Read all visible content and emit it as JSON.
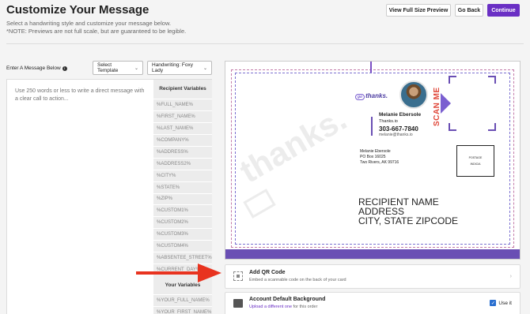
{
  "header": {
    "title": "Customize Your Message",
    "subtitle_line1": "Select a handwriting style and customize your message below.",
    "subtitle_line2": "*NOTE: Previews are not full scale, but are guaranteed to be legible.",
    "view_full_size_label": "View Full Size Preview",
    "go_back_label": "Go Back",
    "continue_label": "Continue"
  },
  "controls": {
    "enter_message_label": "Enter A Message Below",
    "template_select": "Select Template",
    "handwriting_select": "Handwriting: Foxy Lady"
  },
  "message": {
    "placeholder": "Use 250 words or less to write a direct message with a clear call to action..."
  },
  "recipient_variables": {
    "heading": "Recipient Variables",
    "items": [
      "%FULL_NAME%",
      "%FIRST_NAME%",
      "%LAST_NAME%",
      "%COMPANY%",
      "%ADDRESS%",
      "%ADDRESS2%",
      "%CITY%",
      "%STATE%",
      "%ZIP%",
      "%CUSTOM1%",
      "%CUSTOM2%",
      "%CUSTOM3%",
      "%CUSTOM4%",
      "%ABSENTEE_STREET%",
      "%CURRENT_DAY%"
    ]
  },
  "your_variables": {
    "heading": "Your Variables",
    "items": [
      "%YOUR_FULL_NAME%",
      "%YOUR_FIRST_NAME%"
    ]
  },
  "preview": {
    "logo_text": "thanks.",
    "logo_bubble": "go",
    "watermark": "thanks.",
    "sender_name": "Melanie Ebersole",
    "sender_site": "Thanks.io",
    "sender_phone": "303-667-7840",
    "sender_email": "melanie@thanks.io",
    "scan_me": "SCAN ME",
    "return_name": "Melanie Ebersole",
    "return_line1": "PO Box 16025",
    "return_line2": "Two Rivers, AK 99716",
    "postage_line1": "POSTAGE",
    "postage_line2": "INDICIA",
    "recipient_name": "RECIPIENT NAME",
    "recipient_address": "ADDRESS",
    "recipient_city": "CITY, STATE ZIPCODE"
  },
  "qr_option": {
    "title": "Add QR Code",
    "description": "Embed a scannable code on the back of your card"
  },
  "background_option": {
    "title": "Account Default Background",
    "link": "Upload a different one",
    "suffix": " for this order",
    "use_it_label": "Use it",
    "use_it_checked": true
  },
  "colors": {
    "accent": "#6a2fc4",
    "arrow": "#e8331f",
    "scan_me": "#e0483a"
  }
}
